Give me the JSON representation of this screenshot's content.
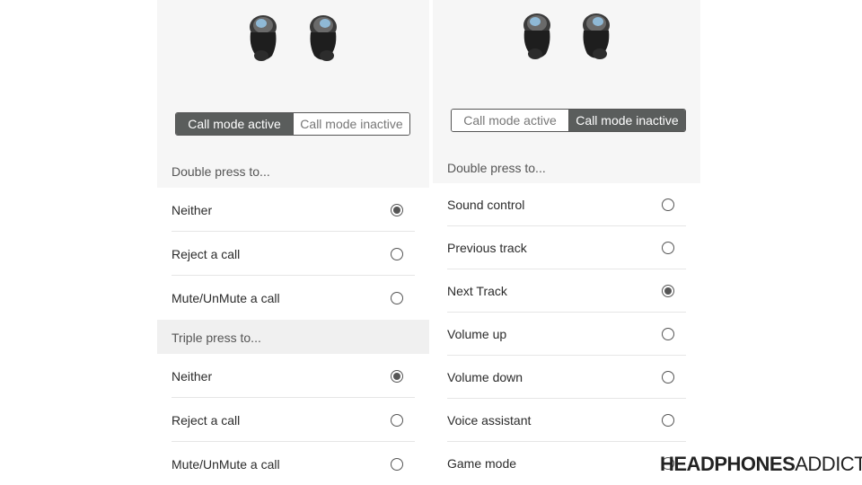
{
  "left_panel": {
    "segmented": {
      "active_label": "Call mode active",
      "inactive_label": "Call mode inactive",
      "selected": "active"
    },
    "sections": [
      {
        "title": "Double press to...",
        "options": [
          {
            "label": "Neither",
            "checked": true
          },
          {
            "label": "Reject a call",
            "checked": false
          },
          {
            "label": "Mute/UnMute a call",
            "checked": false
          }
        ]
      },
      {
        "title": "Triple press to...",
        "options": [
          {
            "label": "Neither",
            "checked": true
          },
          {
            "label": "Reject a call",
            "checked": false
          },
          {
            "label": "Mute/UnMute a call",
            "checked": false
          }
        ]
      }
    ]
  },
  "right_panel": {
    "segmented": {
      "active_label": "Call mode active",
      "inactive_label": "Call mode inactive",
      "selected": "inactive"
    },
    "sections": [
      {
        "title": "Double press to...",
        "options": [
          {
            "label": "Sound control",
            "checked": false
          },
          {
            "label": "Previous track",
            "checked": false
          },
          {
            "label": "Next Track",
            "checked": true
          },
          {
            "label": "Volume up",
            "checked": false
          },
          {
            "label": "Volume down",
            "checked": false
          },
          {
            "label": "Voice assistant",
            "checked": false
          },
          {
            "label": "Game mode",
            "checked": false
          }
        ]
      }
    ]
  },
  "watermark": {
    "strong": "HEADPHONES",
    "light": "ADDICT"
  },
  "colors": {
    "segment_active_bg": "#5a5d5c",
    "panel_bg": "#f6f6f6",
    "radio": "#555555"
  }
}
